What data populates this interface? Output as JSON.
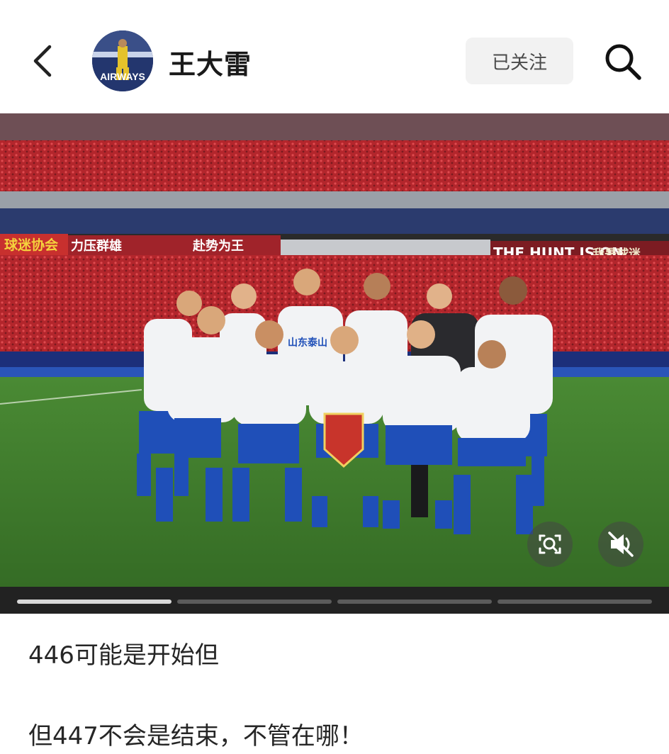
{
  "header": {
    "username": "王大雷",
    "follow_label": "已关注",
    "avatar_text": "AIRWAYS"
  },
  "media": {
    "banners": {
      "left1": "球迷协会",
      "left2": "力压群雄",
      "left3": "赴势为王",
      "right": "THE HUNT IS ON",
      "right2": "我是球迷"
    },
    "jersey_text": "山东泰山",
    "progress": {
      "segments": 4,
      "active_index": 0
    }
  },
  "post": {
    "line1": "446可能是开始但",
    "line2": "但447不会是结束，不管在哪！"
  },
  "colors": {
    "crowd": "#b3262c",
    "pitch": "#3e7a2c",
    "kit_blue": "#1f4fb8"
  }
}
